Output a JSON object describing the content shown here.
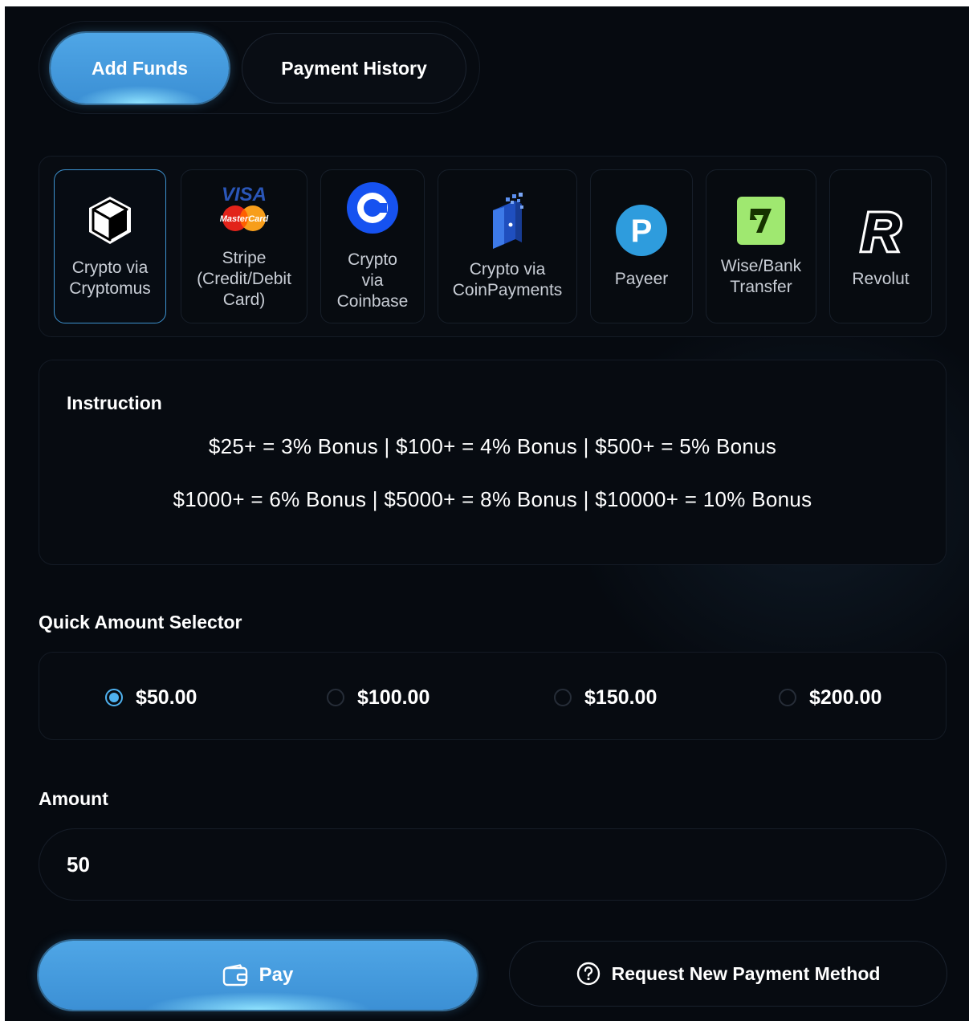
{
  "tabs": [
    {
      "label": "Add Funds",
      "active": true
    },
    {
      "label": "Payment History",
      "active": false
    }
  ],
  "methods": [
    {
      "label": "Crypto via\nCryptomus",
      "icon": "cube-icon",
      "selected": true
    },
    {
      "label": "Stripe\n(Credit/Debit\nCard)",
      "icon": "visa-mastercard-icon",
      "selected": false
    },
    {
      "label": "Crypto\nvia\nCoinbase",
      "icon": "coinbase-icon",
      "selected": false
    },
    {
      "label": "Crypto via\nCoinPayments",
      "icon": "coinpayments-icon",
      "selected": false
    },
    {
      "label": "Payeer",
      "icon": "payeer-icon",
      "selected": false
    },
    {
      "label": "Wise/Bank\nTransfer",
      "icon": "wise-icon",
      "selected": false
    },
    {
      "label": "Revolut",
      "icon": "revolut-icon",
      "selected": false
    }
  ],
  "instruction": {
    "title": "Instruction",
    "line1": "$25+ = 3% Bonus | $100+ = 4% Bonus | $500+ = 5% Bonus",
    "line2": "$1000+ = 6% Bonus | $5000+ = 8% Bonus | $10000+ = 10% Bonus"
  },
  "quick_amount": {
    "label": "Quick Amount Selector",
    "options": [
      {
        "label": "$50.00",
        "checked": true
      },
      {
        "label": "$100.00",
        "checked": false
      },
      {
        "label": "$150.00",
        "checked": false
      },
      {
        "label": "$200.00",
        "checked": false
      }
    ]
  },
  "amount": {
    "label": "Amount",
    "value": "50"
  },
  "actions": {
    "pay_label": "Pay",
    "pay_icon": "wallet-icon",
    "request_label": "Request New Payment Method",
    "request_icon": "question-circle-icon"
  },
  "colors": {
    "accent": "#4fa6e6",
    "background": "#05080d",
    "radio_active": "#4fb2f0"
  }
}
